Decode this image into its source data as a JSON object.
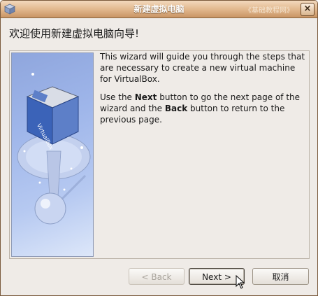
{
  "window": {
    "title": "新建虚拟电脑",
    "watermark": "《基础教程网》",
    "close_label": "×"
  },
  "heading": "欢迎使用新建虚拟电脑向导!",
  "description": {
    "paragraph1": "This wizard will guide you through the steps that are necessary to create a new virtual machine for VirtualBox.",
    "p2_before": "Use the ",
    "p2_next": "Next",
    "p2_middle": " button to go the next page of the wizard and the ",
    "p2_back": "Back",
    "p2_after": " button to return to the previous page."
  },
  "side_image": {
    "logo_text": "VirtualBox"
  },
  "buttons": {
    "back": "< Back",
    "next": "Next >",
    "cancel": "取消"
  },
  "colors": {
    "titlebar": "#d9a978",
    "window_bg": "#efebe7",
    "panel_blue": "#9fb6ea"
  },
  "icons": [
    "virtualbox-app-icon",
    "close-icon",
    "virtualbox-logo-cube",
    "mouse-cursor-icon"
  ]
}
